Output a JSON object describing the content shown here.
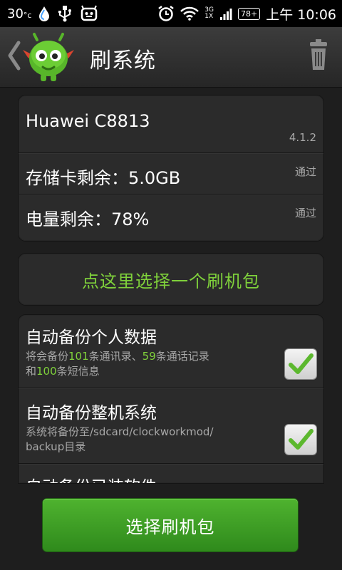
{
  "status_bar": {
    "temperature": "30",
    "temperature_unit": "°c",
    "network_top": "3G",
    "network_bottom": "1X",
    "battery": "78+",
    "time": "上午 10:06"
  },
  "header": {
    "title": "刷系统"
  },
  "device_info": {
    "model": "Huawei C8813",
    "android_version": "4.1.2",
    "storage_label": "存储卡剩余：5.0GB",
    "storage_status": "通过",
    "battery_label": "电量剩余：78%",
    "battery_status": "通过"
  },
  "pick_package": {
    "label": "点这里选择一个刷机包"
  },
  "options": {
    "backup_personal": {
      "title": "自动备份个人数据",
      "desc_prefix": "将会备份",
      "contacts_count": "101",
      "desc_mid1": "条通讯录、",
      "calls_count": "59",
      "desc_mid2": "条通话记录",
      "desc_line2_prefix": "和",
      "sms_count": "100",
      "desc_line2_suffix": "条短信息",
      "checked": true
    },
    "backup_system": {
      "title": "自动备份整机系统",
      "desc_line1": "系统将备份至/sdcard/clockworkmod/",
      "desc_line2": "backup目录",
      "checked": true
    },
    "backup_apps": {
      "title": "自动备份已装软件"
    }
  },
  "footer": {
    "button_label": "选择刷机包"
  },
  "colors": {
    "accent_green": "#7fd13b",
    "button_green": "#3f9f26",
    "background": "#1e1e1e",
    "card": "#2b2b2b"
  },
  "icons": {
    "back": "back-chevron-icon",
    "logo": "android-robot-logo-icon",
    "trash": "trash-can-icon",
    "droplet": "droplet-icon",
    "usb": "usb-icon",
    "robot_face": "robot-face-icon",
    "alarm": "alarm-clock-icon",
    "wifi": "wifi-icon",
    "signal": "signal-bars-icon",
    "checkmark": "checkmark-icon"
  }
}
